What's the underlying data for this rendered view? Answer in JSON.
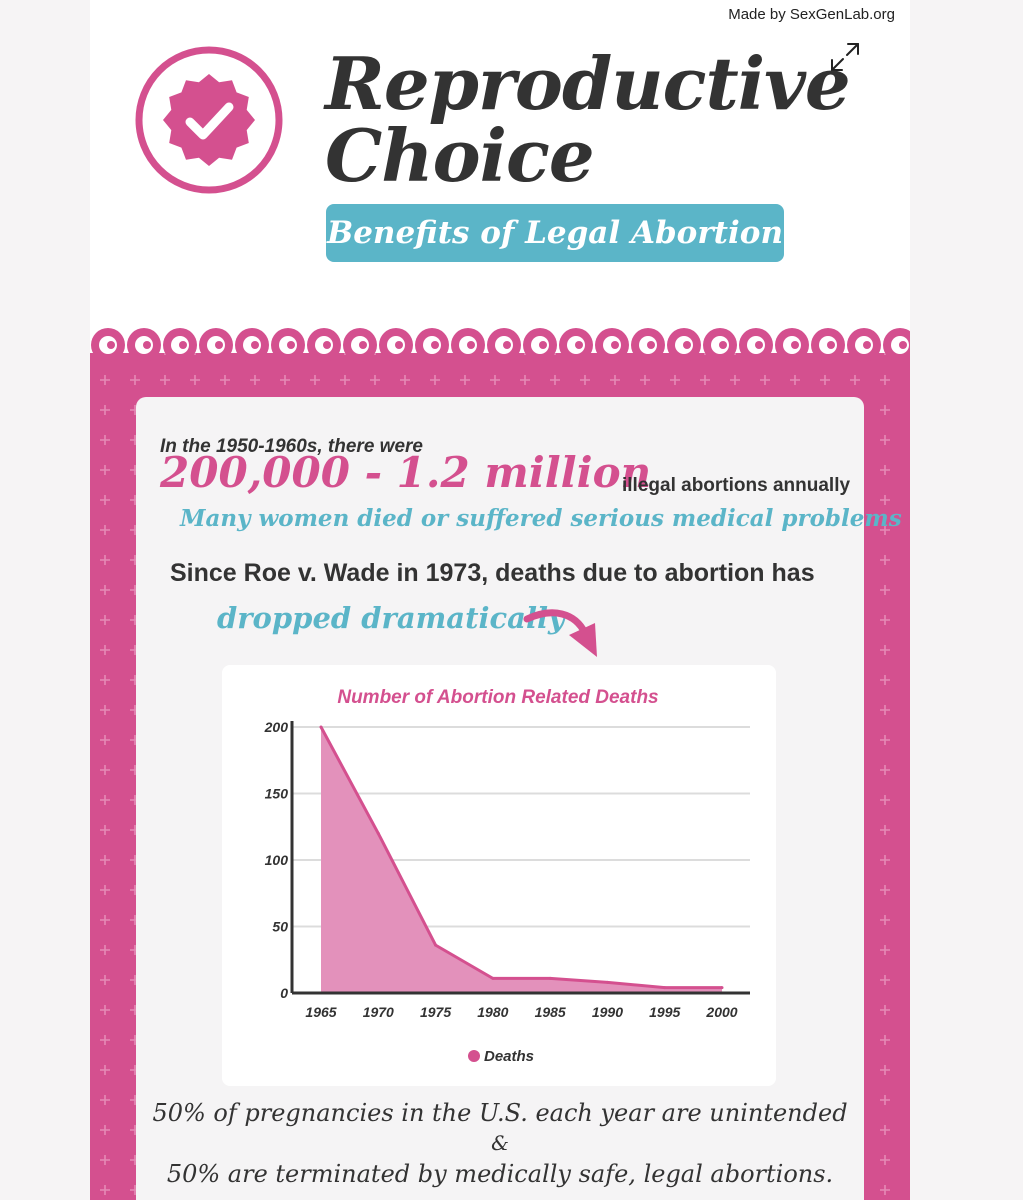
{
  "header": {
    "watermark": "Made by SexGenLab.org",
    "title_line1": "Reproductive",
    "title_line2": "Choice",
    "subtitle": "Benefits of Legal Abortion"
  },
  "intro": {
    "line1": "In the 1950-1960s, there were",
    "big_number": "200,000 - 1.2 million",
    "big_number_tail": "illegal abortions annually",
    "consequence": "Many women died or suffered serious medical problems",
    "roe_line": "Since Roe v. Wade in 1973, deaths due to abortion has",
    "dropped": "dropped dramatically"
  },
  "colors": {
    "pink": "#d4508f",
    "pink_fill": "#e391bb",
    "teal": "#5bb5c8",
    "dark": "#333333"
  },
  "chart_data": {
    "type": "area",
    "title": "Number of Abortion Related Deaths",
    "xlabel": "",
    "ylabel": "",
    "x": [
      1965,
      1970,
      1975,
      1980,
      1985,
      1990,
      1995,
      2000
    ],
    "series": [
      {
        "name": "Deaths",
        "values": [
          200,
          120,
          36,
          11,
          11,
          8,
          4,
          4
        ]
      }
    ],
    "ylim": [
      0,
      200
    ],
    "yticks": [
      0,
      50,
      100,
      150,
      200
    ],
    "grid": true,
    "legend": "bottom"
  },
  "footer": {
    "line1": "50% of pregnancies in the U.S. each year are unintended",
    "line2": "&",
    "line3": "50% are terminated by medically safe, legal abortions."
  }
}
